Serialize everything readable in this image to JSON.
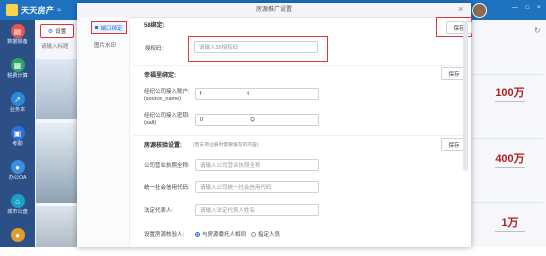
{
  "app": {
    "name": "天天房产",
    "user": "",
    "window_controls": "— □ ×"
  },
  "leftnav": {
    "items": [
      {
        "label": "数据报备",
        "icon": "report-icon",
        "color": "#e8554e"
      },
      {
        "label": "税费计算",
        "icon": "calculator-icon",
        "color": "#2fa36b"
      },
      {
        "label": "业务本",
        "icon": "chart-icon",
        "color": "#2a8ad8"
      },
      {
        "label": "考勤",
        "icon": "calendar-icon",
        "color": "#2a6fdb"
      },
      {
        "label": "办公OA",
        "icon": "user-icon",
        "color": "#3c8de0"
      },
      {
        "label": "城市公盘",
        "icon": "home-icon",
        "color": "#1aa1c4"
      },
      {
        "label": "",
        "icon": "more-icon",
        "color": "#e39b2b"
      }
    ]
  },
  "listpanel": {
    "settings_button": "设置",
    "hint": "请输入标题"
  },
  "dialog": {
    "title": "房源推广设置",
    "close": "×",
    "side_tabs": [
      "端口绑定",
      "图片水印"
    ],
    "section1": {
      "title": "58绑定:",
      "auth_label": "授权码:",
      "auth_placeholder": "请输入58授权码",
      "save": "保存"
    },
    "section2": {
      "title": "幸福里绑定:",
      "account_label": "经纪公司接入账户:\n(source_name)",
      "account_value": "f                              t",
      "key_label": "经纪公司接入密钥:\n(salt)",
      "key_value": "0                               Q",
      "save": "保存"
    },
    "section3": {
      "title": "房源核验设置:",
      "note": "(若支持注册时需要填写的内容)",
      "license_label": "公司营业执照全称:",
      "license_placeholder": "请输入公司营业执照全称",
      "credit_label": "统一社会信用代码:",
      "credit_placeholder": "请输入公司统一社会信用代码",
      "legal_label": "法定代表人:",
      "legal_placeholder": "请输入法定代表人姓名",
      "verify_label": "设置房源核验人:",
      "radio_options": [
        "与房源委托人相同",
        "指定人员"
      ],
      "radio_selected": 0,
      "save": "保存"
    }
  },
  "right": {
    "stats": [
      {
        "value": "100万",
        "sub": "——————"
      },
      {
        "value": "400万",
        "sub": "——————"
      },
      {
        "value": "1万",
        "sub": "——————"
      }
    ]
  },
  "colors": {
    "topbar": "#1f72c0",
    "nav": "#2c4f86",
    "accent": "#2a6fdb",
    "highlight": "#d93636",
    "stat": "#b21e1e"
  }
}
